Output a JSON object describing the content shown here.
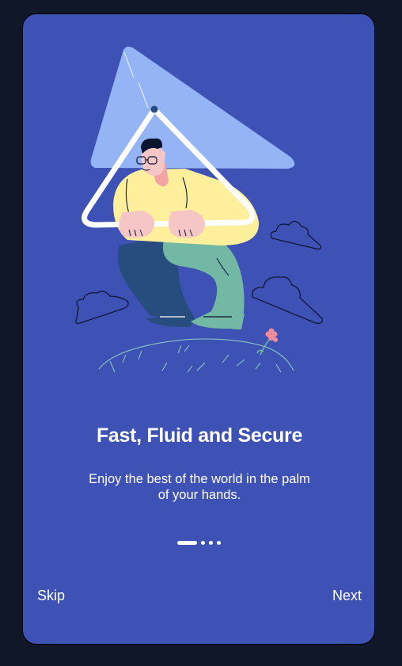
{
  "onboarding": {
    "title": "Fast, Fluid and Secure",
    "subtitle": "Enjoy the best of the world in the palm of your hands.",
    "pagination": {
      "total": 4,
      "current": 1
    },
    "skip_label": "Skip",
    "next_label": "Next"
  },
  "colors": {
    "background": "#0f1729",
    "card": "#3e51b5",
    "text": "#ffffff"
  }
}
